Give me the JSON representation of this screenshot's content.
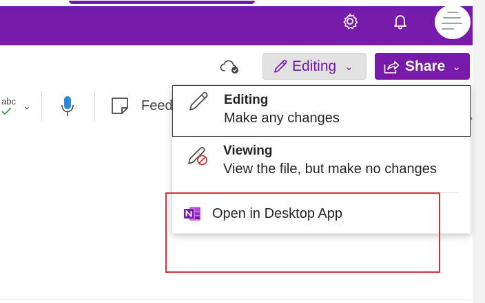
{
  "header": {
    "settings_icon": "gear-icon",
    "notifications_icon": "bell-icon",
    "avatar": "avatar"
  },
  "command_bar": {
    "sync_icon": "cloud-check-icon",
    "mode_button": {
      "label": "Editing",
      "icon": "pencil-icon"
    },
    "share_button": {
      "label": "Share",
      "icon": "share-icon"
    }
  },
  "toolbar": {
    "spelling_label": "abc",
    "feedback_label": "Feed"
  },
  "mode_menu": {
    "items": [
      {
        "title": "Editing",
        "subtitle": "Make any changes",
        "icon": "pencil-icon",
        "selected": true
      },
      {
        "title": "Viewing",
        "subtitle": "View the file, but make no changes",
        "icon": "pencil-blocked-icon",
        "selected": false
      }
    ],
    "open_desktop": {
      "label": "Open in Desktop App",
      "icon": "onenote-icon"
    }
  },
  "colors": {
    "brand": "#7719aa",
    "highlight": "#d8303b",
    "mic": "#2b88d8"
  }
}
